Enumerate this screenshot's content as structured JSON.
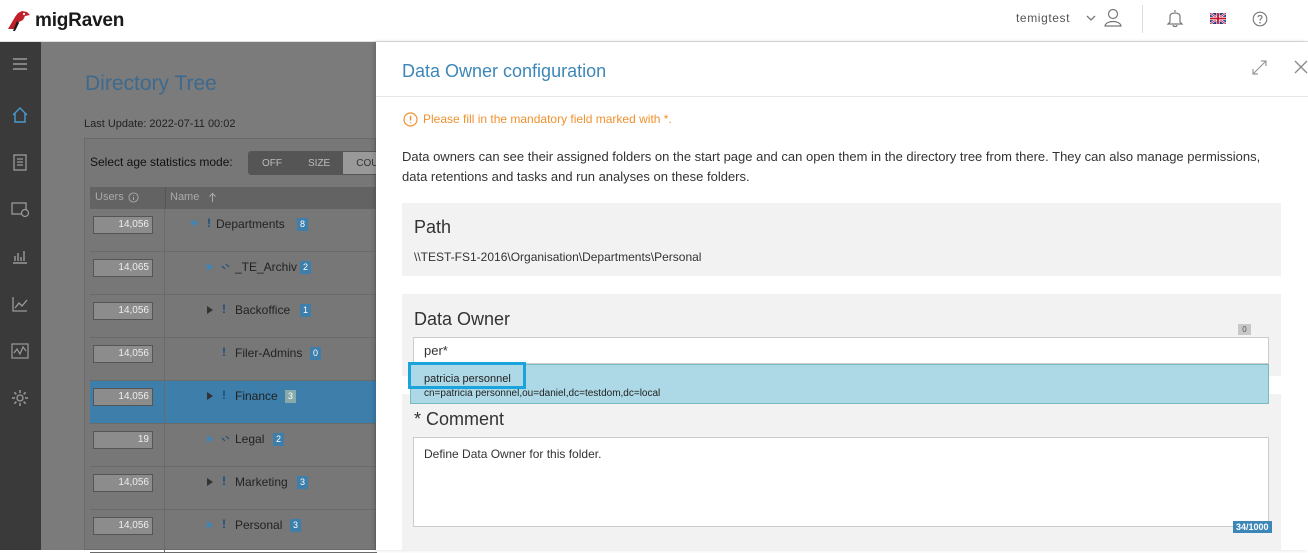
{
  "app": {
    "brand": "migRaven"
  },
  "header": {
    "username": "temigtest"
  },
  "background": {
    "title": "Directory Tree",
    "last_update": "Last Update: 2022-07-11 00:02",
    "age_label": "Select age statistics mode:",
    "modes": [
      "OFF",
      "SIZE",
      "COU"
    ],
    "columns": {
      "users": "Users",
      "name": "Name"
    },
    "rows": [
      {
        "users": "14,056",
        "name": "Departments",
        "count": "8",
        "expanded": true
      },
      {
        "users": "14,065",
        "name": "_TE_Archiv",
        "count": "2"
      },
      {
        "users": "14,056",
        "name": "Backoffice",
        "count": "1"
      },
      {
        "users": "14,056",
        "name": "Filer-Admins",
        "count": "0"
      },
      {
        "users": "14,056",
        "name": "Finance",
        "count": "3",
        "selected": true
      },
      {
        "users": "19",
        "name": "Legal",
        "count": "2"
      },
      {
        "users": "14,056",
        "name": "Marketing",
        "count": "3"
      },
      {
        "users": "14,056",
        "name": "Personal",
        "count": "3"
      }
    ]
  },
  "drawer": {
    "title": "Data Owner configuration",
    "warning": "Please fill in the mandatory field marked with *.",
    "description": "Data owners can see their assigned folders on the start page and can open them in the directory tree from there. They can also manage permissions, data retentions and tasks and run analyses on these folders.",
    "path": {
      "title": "Path",
      "value": "\\\\TEST-FS1-2016\\Organisation\\Departments\\Personal"
    },
    "owner": {
      "title": "Data Owner",
      "count": "0",
      "input_value": "per*"
    },
    "suggestion": {
      "name": "patricia personnel",
      "dn": "cn=patricia personnel,ou=daniel,dc=testdom,dc=local"
    },
    "comment": {
      "title": "* Comment",
      "value": "Define Data Owner for this folder.",
      "char_count": "34/1000"
    }
  },
  "colors": {
    "accent": "#3d87b8",
    "warning": "#f0912f",
    "highlight": "#1aa3dc",
    "suggestion_bg": "#add8e6"
  }
}
